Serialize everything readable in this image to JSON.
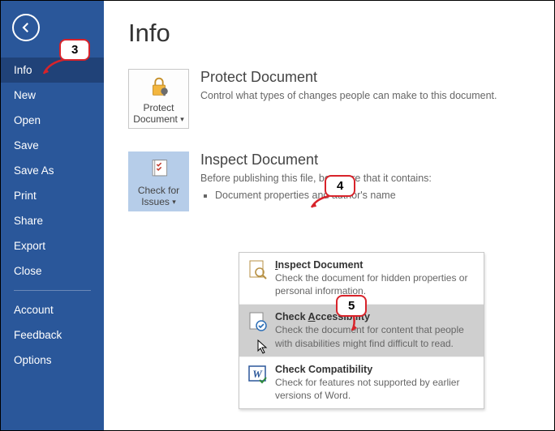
{
  "sidebar": {
    "items": [
      {
        "label": "Info",
        "selected": true
      },
      {
        "label": "New"
      },
      {
        "label": "Open"
      },
      {
        "label": "Save"
      },
      {
        "label": "Save As"
      },
      {
        "label": "Print"
      },
      {
        "label": "Share"
      },
      {
        "label": "Export"
      },
      {
        "label": "Close"
      }
    ],
    "bottom_items": [
      {
        "label": "Account"
      },
      {
        "label": "Feedback"
      },
      {
        "label": "Options"
      }
    ]
  },
  "page": {
    "title": "Info"
  },
  "protect": {
    "button_line1": "Protect",
    "button_line2": "Document",
    "title": "Protect Document",
    "desc": "Control what types of changes people can make to this document."
  },
  "inspect": {
    "button_line1": "Check for",
    "button_line2": "Issues",
    "title": "Inspect Document",
    "desc": "Before publishing this file, be aware that it contains:",
    "bullet1": "Document properties and author's name"
  },
  "dropdown": {
    "items": [
      {
        "title_pre": "I",
        "title_rest": "nspect Document",
        "desc": "Check the document for hidden properties or personal information."
      },
      {
        "title_pre": "Check ",
        "title_u": "A",
        "title_post": "ccessibility",
        "desc": "Check the document for content that people with disabilities might find difficult to read.",
        "hover": true
      },
      {
        "title": "Check Compatibility",
        "desc": "Check for features not supported by earlier versions of Word."
      }
    ]
  },
  "callouts": {
    "c3": "3",
    "c4": "4",
    "c5": "5"
  }
}
